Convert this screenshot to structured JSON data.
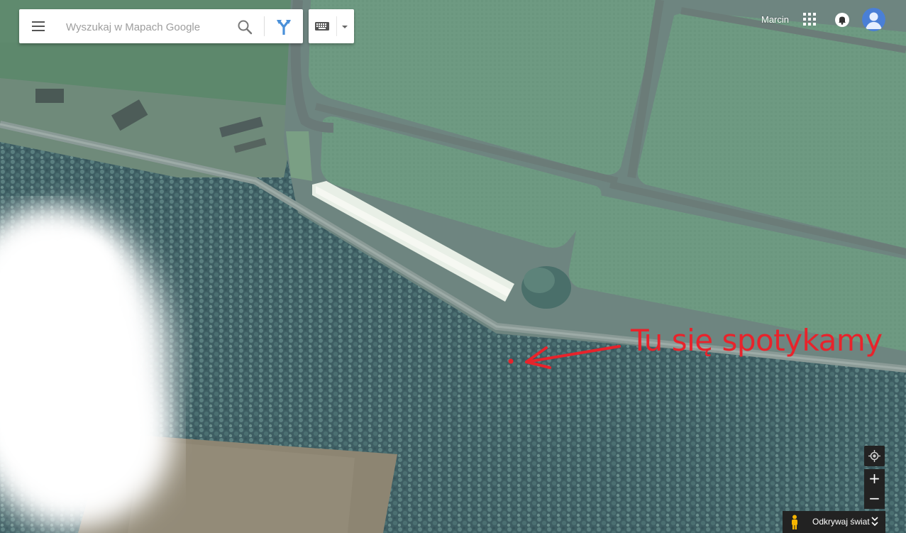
{
  "search": {
    "placeholder": "Wyszukaj w Mapach Google"
  },
  "account": {
    "user_name": "Marcin"
  },
  "annotation": {
    "text": "Tu się spotykamy"
  },
  "controls": {
    "zoom_in": "+",
    "zoom_out": "−"
  },
  "explore": {
    "label": "Odkrywaj świat"
  },
  "icons": [
    "menu-icon",
    "search-icon",
    "directions-icon",
    "keyboard-icon",
    "dropdown-arrow-icon",
    "apps-grid-icon",
    "notifications-icon",
    "avatar-icon",
    "my-location-icon",
    "pegman-icon",
    "chevron-icon"
  ],
  "colors": {
    "annotation": "#e8232b",
    "accent": "#4285f4",
    "control_bg": "#222222"
  }
}
